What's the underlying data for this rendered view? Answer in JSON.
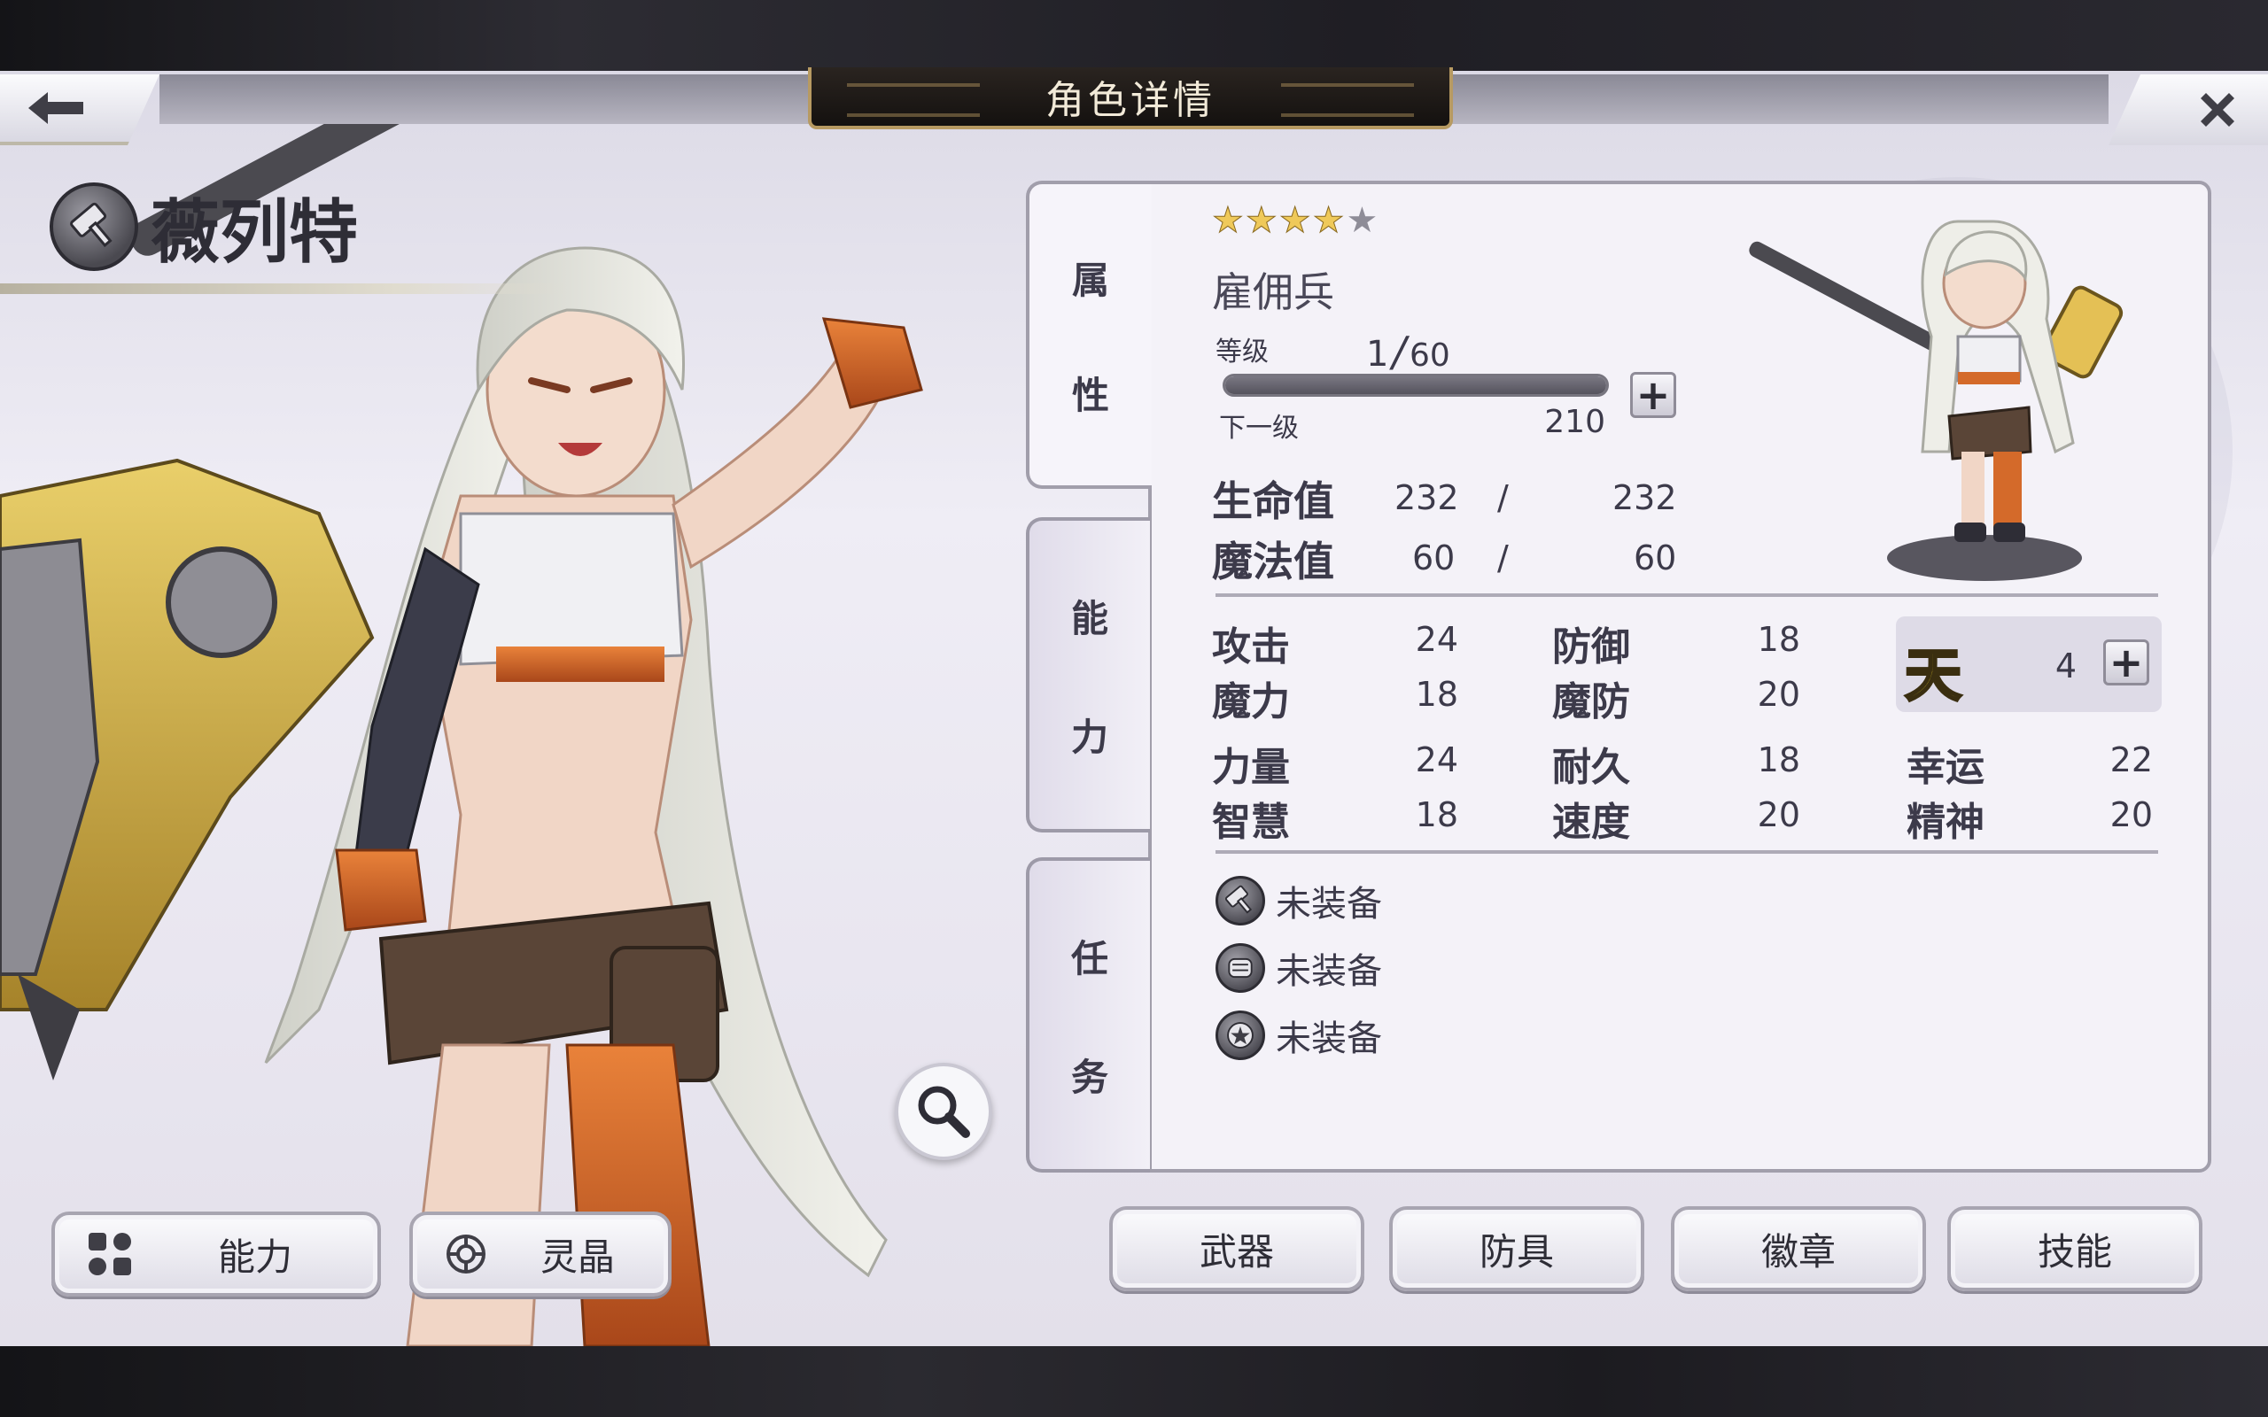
{
  "header": {
    "title": "角色详情",
    "back_icon": "arrow-left-icon",
    "close_icon": "close-icon"
  },
  "character": {
    "name": "薇列特",
    "class_icon": "hammer-icon",
    "stars_filled": 4,
    "stars_total": 5,
    "job": "雇佣兵",
    "level_label": "等级",
    "level_current": "1",
    "level_slash": "/",
    "level_max": "60",
    "exp_fraction": 1.0,
    "next_label": "下一级",
    "next_value": "210",
    "hp_label": "生命值",
    "hp_current": "232",
    "hp_slash": "/",
    "hp_max": "232",
    "mp_label": "魔法值",
    "mp_current": "60",
    "mp_slash": "/",
    "mp_max": "60"
  },
  "tabs": [
    {
      "c1": "属",
      "c2": "性"
    },
    {
      "c1": "能",
      "c2": "力"
    },
    {
      "c1": "任",
      "c2": "务"
    }
  ],
  "stats": {
    "attack_label": "攻击",
    "attack": "24",
    "defense_label": "防御",
    "defense": "18",
    "magic_label": "魔力",
    "magic": "18",
    "mdef_label": "魔防",
    "mdef": "20",
    "strength_label": "力量",
    "strength": "24",
    "endurance_label": "耐久",
    "endurance": "18",
    "luck_label": "幸运",
    "luck": "22",
    "wisdom_label": "智慧",
    "wisdom": "18",
    "speed_label": "速度",
    "speed": "20",
    "spirit_label": "精神",
    "spirit": "20",
    "sky_glyph": "天",
    "sky_value": "4"
  },
  "equipment": [
    {
      "icon": "hammer-icon",
      "label": "未装备"
    },
    {
      "icon": "armor-icon",
      "label": "未装备"
    },
    {
      "icon": "badge-star-icon",
      "label": "未装备"
    }
  ],
  "bottom_left_buttons": [
    {
      "icon": "grid-icon",
      "label": "能力"
    },
    {
      "icon": "crystal-icon",
      "label": "灵晶"
    }
  ],
  "bottom_right_buttons": [
    {
      "label": "武器"
    },
    {
      "label": "防具"
    },
    {
      "label": "徽章"
    },
    {
      "label": "技能"
    }
  ],
  "colors": {
    "accent_gold": "#b79a62",
    "panel_bg": "#f4f2f8",
    "sky_yellow": "#f5d82a"
  }
}
